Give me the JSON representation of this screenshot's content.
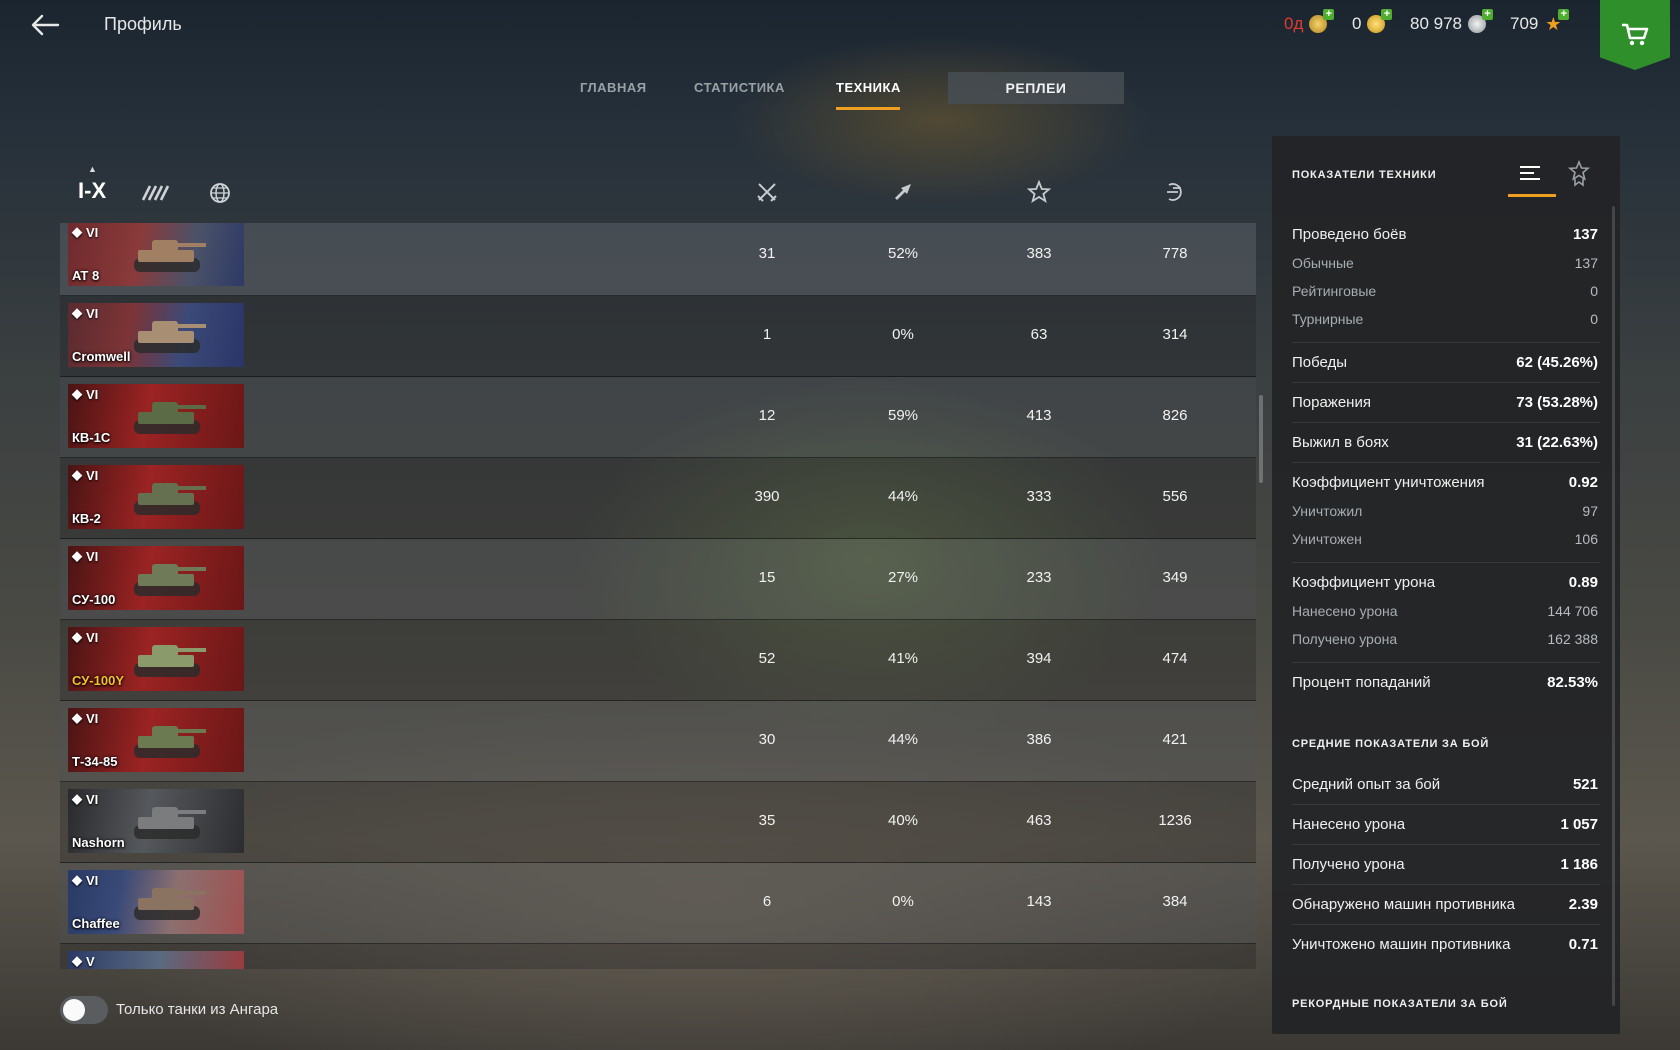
{
  "header": {
    "title": "Профиль",
    "currencies": [
      {
        "value": "0д",
        "icon": "premium-icon",
        "color": "#e33a2c"
      },
      {
        "value": "0",
        "icon": "gold-icon",
        "color": "#f0f0f0"
      },
      {
        "value": "80 978",
        "icon": "credits-icon",
        "color": "#f0f0f0"
      },
      {
        "value": "709",
        "icon": "free-xp-icon",
        "color": "#f0f0f0"
      }
    ]
  },
  "tabs": [
    {
      "label": "ГЛАВНАЯ"
    },
    {
      "label": "СТАТИСТИКА"
    },
    {
      "label": "ТЕХНИКА"
    },
    {
      "label": "РЕПЛЕИ"
    }
  ],
  "filters": {
    "tier_label": "I-X"
  },
  "vehicles": [
    {
      "tier": "VI",
      "name": "AT 8",
      "battles": "31",
      "winrate": "52%",
      "exp": "383",
      "damage": "778",
      "gold": false
    },
    {
      "tier": "VI",
      "name": "Cromwell",
      "battles": "1",
      "winrate": "0%",
      "exp": "63",
      "damage": "314",
      "gold": false
    },
    {
      "tier": "VI",
      "name": "КВ-1С",
      "battles": "12",
      "winrate": "59%",
      "exp": "413",
      "damage": "826",
      "gold": false
    },
    {
      "tier": "VI",
      "name": "КВ-2",
      "battles": "390",
      "winrate": "44%",
      "exp": "333",
      "damage": "556",
      "gold": false
    },
    {
      "tier": "VI",
      "name": "СУ-100",
      "battles": "15",
      "winrate": "27%",
      "exp": "233",
      "damage": "349",
      "gold": false
    },
    {
      "tier": "VI",
      "name": "СУ-100Y",
      "battles": "52",
      "winrate": "41%",
      "exp": "394",
      "damage": "474",
      "gold": true
    },
    {
      "tier": "VI",
      "name": "Т-34-85",
      "battles": "30",
      "winrate": "44%",
      "exp": "386",
      "damage": "421",
      "gold": false
    },
    {
      "tier": "VI",
      "name": "Nashorn",
      "battles": "35",
      "winrate": "40%",
      "exp": "463",
      "damage": "1236",
      "gold": false
    },
    {
      "tier": "VI",
      "name": "Chaffee",
      "battles": "6",
      "winrate": "0%",
      "exp": "143",
      "damage": "384",
      "gold": false
    },
    {
      "tier": "V",
      "name": "",
      "battles": "",
      "winrate": "",
      "exp": "",
      "damage": "",
      "gold": false
    }
  ],
  "toggle": {
    "label": "Только танки из Ангара"
  },
  "panel": {
    "title": "ПОКАЗАТЕЛИ ТЕХНИКИ",
    "stats": {
      "battles": {
        "label": "Проведено боёв",
        "value": "137"
      },
      "regular": {
        "label": "Обычные",
        "value": "137"
      },
      "ranked": {
        "label": "Рейтинговые",
        "value": "0"
      },
      "tournament": {
        "label": "Турнирные",
        "value": "0"
      },
      "wins": {
        "label": "Победы",
        "value": "62 (45.26%)"
      },
      "losses": {
        "label": "Поражения",
        "value": "73 (53.28%)"
      },
      "survived": {
        "label": "Выжил в боях",
        "value": "31 (22.63%)"
      },
      "kd": {
        "label": "Коэффициент уничтожения",
        "value": "0.92"
      },
      "killed": {
        "label": "Уничтожил",
        "value": "97"
      },
      "destroyed": {
        "label": "Уничтожен",
        "value": "106"
      },
      "dmg_ratio": {
        "label": "Коэффициент урона",
        "value": "0.89"
      },
      "dmg_dealt": {
        "label": "Нанесено урона",
        "value": "144 706"
      },
      "dmg_received": {
        "label": "Получено урона",
        "value": "162 388"
      },
      "hit_rate": {
        "label": "Процент попаданий",
        "value": "82.53%"
      }
    },
    "avg_title": "СРЕДНИЕ ПОКАЗАТЕЛИ ЗА БОЙ",
    "avg": {
      "xp": {
        "label": "Средний опыт за бой",
        "value": "521"
      },
      "dealt": {
        "label": "Нанесено урона",
        "value": "1 057"
      },
      "received": {
        "label": "Получено урона",
        "value": "1 186"
      },
      "spotted": {
        "label": "Обнаружено машин противника",
        "value": "2.39"
      },
      "frags": {
        "label": "Уничтожено машин противника",
        "value": "0.71"
      }
    },
    "record_title": "РЕКОРДНЫЕ ПОКАЗАТЕЛИ ЗА БОЙ"
  }
}
